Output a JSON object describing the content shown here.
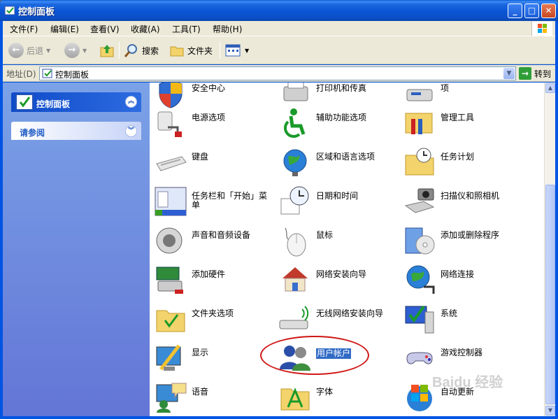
{
  "window": {
    "title": "控制面板",
    "min": "_",
    "max": "□",
    "close": "✕"
  },
  "menu": [
    "文件(F)",
    "编辑(E)",
    "查看(V)",
    "收藏(A)",
    "工具(T)",
    "帮助(H)"
  ],
  "toolbar": {
    "back": "后退",
    "search": "搜索",
    "folders": "文件夹"
  },
  "address": {
    "label": "地址(D)",
    "value": "控制面板",
    "go": "转到"
  },
  "side": {
    "main_title": "控制面板",
    "see_also": "请参阅"
  },
  "items": [
    {
      "label": "安全中心",
      "icon": "security-center-icon"
    },
    {
      "label": "打印机和传真",
      "icon": "printer-icon"
    },
    {
      "label": "项",
      "icon": "phone-modem-icon"
    },
    {
      "label": "电源选项",
      "icon": "power-options-icon"
    },
    {
      "label": "辅助功能选项",
      "icon": "accessibility-icon"
    },
    {
      "label": "管理工具",
      "icon": "admin-tools-icon"
    },
    {
      "label": "键盘",
      "icon": "keyboard-icon"
    },
    {
      "label": "区域和语言选项",
      "icon": "globe-region-icon"
    },
    {
      "label": "任务计划",
      "icon": "scheduled-tasks-icon"
    },
    {
      "label": "任务栏和「开始」菜单",
      "icon": "taskbar-icon"
    },
    {
      "label": "日期和时间",
      "icon": "clock-calendar-icon"
    },
    {
      "label": "扫描仪和照相机",
      "icon": "scanner-camera-icon"
    },
    {
      "label": "声音和音频设备",
      "icon": "speaker-icon"
    },
    {
      "label": "鼠标",
      "icon": "mouse-icon"
    },
    {
      "label": "添加或删除程序",
      "icon": "add-remove-programs-icon"
    },
    {
      "label": "添加硬件",
      "icon": "add-hardware-icon"
    },
    {
      "label": "网络安装向导",
      "icon": "network-setup-icon"
    },
    {
      "label": "网络连接",
      "icon": "network-connections-icon"
    },
    {
      "label": "文件夹选项",
      "icon": "folder-options-icon"
    },
    {
      "label": "无线网络安装向导",
      "icon": "wireless-setup-icon"
    },
    {
      "label": "系统",
      "icon": "system-icon"
    },
    {
      "label": "显示",
      "icon": "display-icon"
    },
    {
      "label": "用户帐户",
      "icon": "user-accounts-icon",
      "selected": true
    },
    {
      "label": "游戏控制器",
      "icon": "game-controller-icon"
    },
    {
      "label": "语音",
      "icon": "speech-icon"
    },
    {
      "label": "字体",
      "icon": "fonts-icon"
    },
    {
      "label": "自动更新",
      "icon": "automatic-updates-icon"
    }
  ],
  "watermark": "Baidu 经验"
}
